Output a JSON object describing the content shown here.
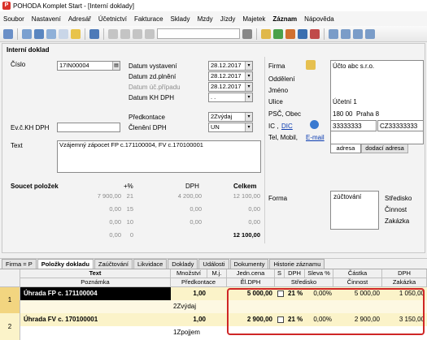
{
  "window": {
    "title": "POHODA Komplet Start - [Interní doklady]"
  },
  "menu": [
    "Soubor",
    "Nastavení",
    "Adresář",
    "Účetnictví",
    "Fakturace",
    "Sklady",
    "Mzdy",
    "Jízdy",
    "Majetek",
    "Záznam",
    "Nápověda"
  ],
  "panel": {
    "title": "Interní doklad"
  },
  "form": {
    "cislo_label": "Číslo",
    "cislo_value": "17IN00004",
    "evc_label": "Ev.č.KH DPH",
    "text_label": "Text",
    "text_value": "Vzájemný zápocet FP c.171100004, FV c.170100001",
    "datum_vystaveni_label": "Datum vystavení",
    "datum_vystaveni": "28.12.2017",
    "datum_zdplneni_label": "Datum zd.plnění",
    "datum_zdplneni": "28.12.2017",
    "datum_ucprip_label": "Datum úč.případu",
    "datum_ucprip": "28.12.2017",
    "datum_kh_label": "Datum KH DPH",
    "datum_kh": ". .",
    "predkontace_label": "Předkontace",
    "predkontace": "2Zvýdaj",
    "cleneni_label": "Členění DPH",
    "cleneni": "UN"
  },
  "address": {
    "firma_label": "Firma",
    "firma": "Účto abc s.r.o.",
    "oddeleni_label": "Oddělení",
    "jmeno_label": "Jméno",
    "ulice_label": "Ulice",
    "ulice": "Účetní 1",
    "psc_label": "PSČ, Obec",
    "psc": "180 00",
    "obec": "Praha 8",
    "ic_label": "IC ,",
    "dic_label": "DIC",
    "ic": "33333333",
    "dic": "CZ33333333",
    "tel_label": "Tel, Mobil,",
    "email_label": "E-mail",
    "tab_adresa": "adresa",
    "tab_dodaci": "dodací adresa"
  },
  "summary": {
    "title": "Soucet položek",
    "h_rate": "+%",
    "h_dph": "DPH",
    "h_total": "Celkem",
    "rows": [
      {
        "base": "7 900,00",
        "rate": "21",
        "dph": "4 200,00",
        "total": "12 100,00"
      },
      {
        "base": "0,00",
        "rate": "15",
        "dph": "0,00",
        "total": "0,00"
      },
      {
        "base": "0,00",
        "rate": "10",
        "dph": "0,00",
        "total": "0,00"
      },
      {
        "base": "0,00",
        "rate": "0",
        "dph": "",
        "total": "12 100,00"
      }
    ]
  },
  "right": {
    "forma_label": "Forma",
    "forma": "zúčtování",
    "stredisko": "Středisko",
    "cinnost": "Činnost",
    "zakazka": "Zakázka"
  },
  "tabs": [
    "Firma = P",
    "Položky dokladu",
    "Zaúčtování",
    "Likvidace",
    "Doklady",
    "Události",
    "Dokumenty",
    "Historie záznamu"
  ],
  "grid": {
    "headers1": [
      "Text",
      "Množství",
      "M.j.",
      "Jedn.cena",
      "S",
      "DPH",
      "Sleva %",
      "Částka",
      "DPH"
    ],
    "headers2": [
      "Poznámka",
      "Předkontace",
      "Ěl.DPH",
      "Středisko",
      "Činnost",
      "Zakázka"
    ],
    "rows": [
      {
        "num": "1",
        "text": "Úhrada FP c. 171100004",
        "qty": "1,00",
        "price": "5 000,00",
        "dph": "21 %",
        "sleva": "0,00%",
        "castka": "5 000,00",
        "dphval": "1 050,00",
        "predkontace": "2Zvýdaj"
      },
      {
        "num": "2",
        "text": "Úhrada FV c. 170100001",
        "qty": "1,00",
        "price": "2 900,00",
        "dph": "21 %",
        "sleva": "0,00%",
        "castka": "2 900,00",
        "dphval": "3 150,00",
        "predkontace": "1Zpojjem"
      }
    ]
  },
  "colors": {
    "accent_row": "#f2d580",
    "highlight_border": "#cf2626",
    "title_bg": "#ffffff"
  }
}
